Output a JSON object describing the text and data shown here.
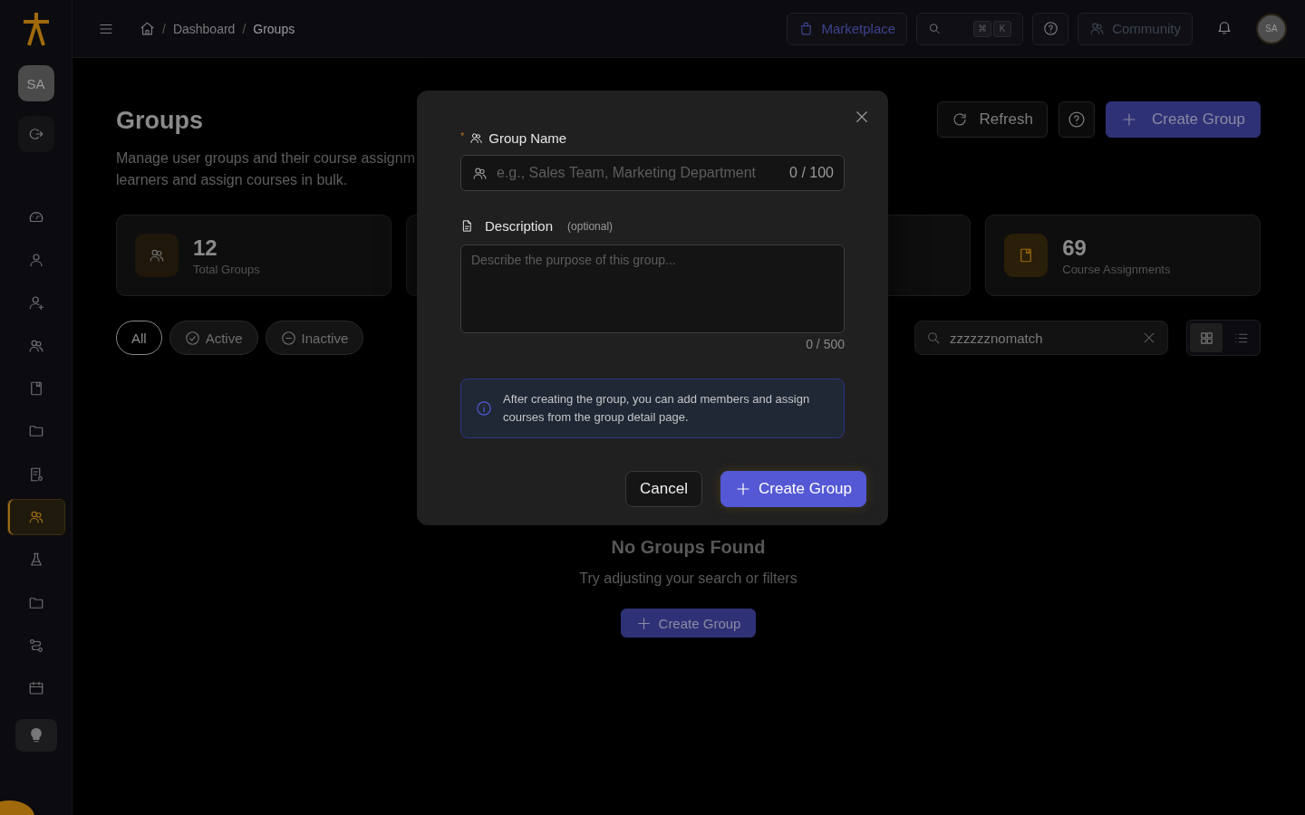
{
  "sidebar": {
    "avatar": "SA",
    "items": [
      {
        "selected": false
      },
      {
        "selected": false
      },
      {
        "selected": false
      },
      {
        "selected": false
      },
      {
        "selected": false
      },
      {
        "selected": false
      },
      {
        "selected": false
      },
      {
        "selected": true
      },
      {
        "selected": false
      },
      {
        "selected": false
      },
      {
        "selected": false
      },
      {
        "selected": false
      }
    ]
  },
  "breadcrumbs": [
    {
      "separator": "/",
      "label": "Dashboard"
    },
    {
      "separator": "/",
      "label": "Groups"
    }
  ],
  "topbar": {
    "marketplace": "Marketplace",
    "shortcut_keys": [
      "⌘",
      "K"
    ],
    "community": "Community",
    "avatar": "SA"
  },
  "page": {
    "title": "Groups",
    "description_lines": [
      "Manage user groups and their course assignm",
      "learners and assign courses in bulk."
    ],
    "actions": {
      "refresh": "Refresh",
      "create": "Create Group"
    },
    "stats": [
      {
        "value": "12",
        "label": "Total Groups",
        "kind": "groups"
      },
      {
        "value": "69",
        "label": "Course Assignments",
        "kind": "courses"
      }
    ],
    "filters": [
      {
        "label": "All",
        "selected": true
      },
      {
        "label": "Active",
        "selected": false
      },
      {
        "label": "Inactive",
        "selected": false
      }
    ],
    "search": {
      "value": "zzzzzznomatch"
    },
    "view_modes": [
      {
        "selected": true
      },
      {
        "selected": false
      }
    ],
    "empty_state": {
      "title": "No Groups Found",
      "message": "Try adjusting your search or filters",
      "button": "Create Group"
    }
  },
  "modal": {
    "name_field": {
      "required_mark": "*",
      "label": "Group Name",
      "placeholder": "e.g., Sales Team, Marketing Department",
      "counter": "0 / 100"
    },
    "description_field": {
      "label": "Description",
      "hint": "(optional)",
      "placeholder": "Describe the purpose of this group...",
      "counter": "0 / 500"
    },
    "info": "After creating the group, you can add members and assign courses from the group detail page.",
    "buttons": [
      {
        "label": "Cancel",
        "kind": "secondary"
      },
      {
        "label": "Create Group",
        "kind": "primary"
      }
    ]
  }
}
